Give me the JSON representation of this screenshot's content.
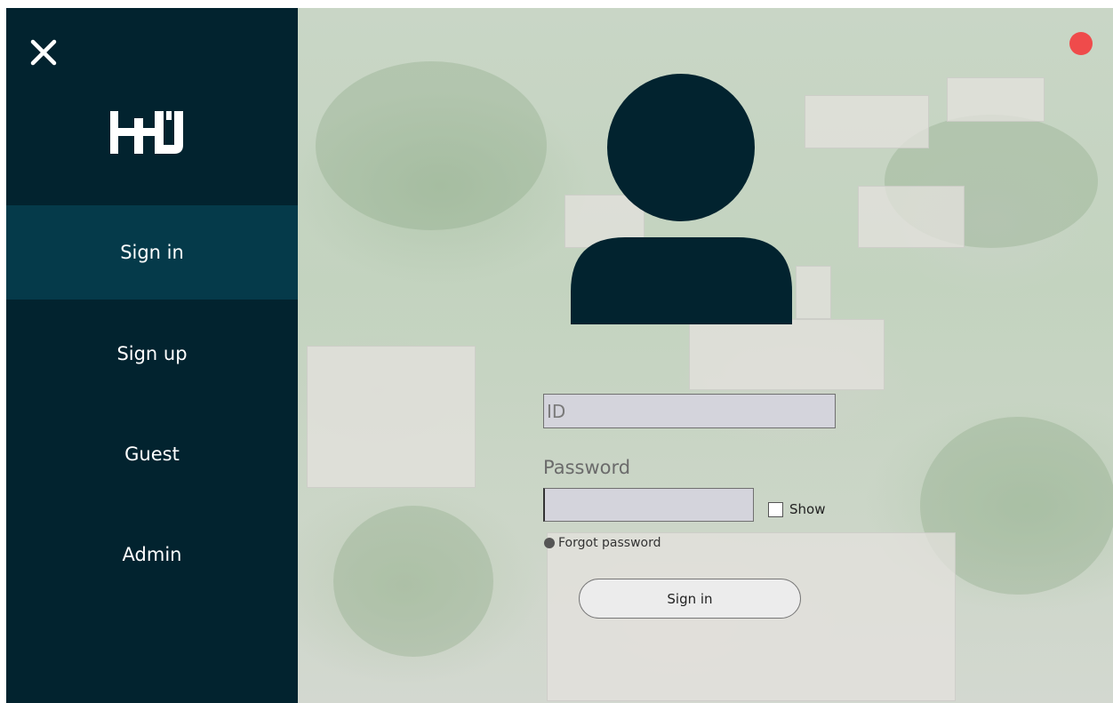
{
  "sidebar": {
    "close_icon": "close-icon",
    "logo_text": "HHJ",
    "items": [
      {
        "label": "Sign in",
        "active": true
      },
      {
        "label": "Sign up",
        "active": false
      },
      {
        "label": "Guest",
        "active": false
      },
      {
        "label": "Admin",
        "active": false
      }
    ]
  },
  "main": {
    "avatar_icon": "user-avatar-icon",
    "id_field": {
      "placeholder": "ID",
      "value": ""
    },
    "password_label": "Password",
    "password_field": {
      "value": ""
    },
    "show_label": "Show",
    "show_checked": false,
    "forgot_label": "Forgot password",
    "signin_button": "Sign in"
  },
  "colors": {
    "sidebar_bg": "#02232f",
    "sidebar_active": "#053a4a",
    "avatar": "#02232f",
    "status_dot": "#ef4b4b",
    "input_bg": "#d4d4dc"
  }
}
